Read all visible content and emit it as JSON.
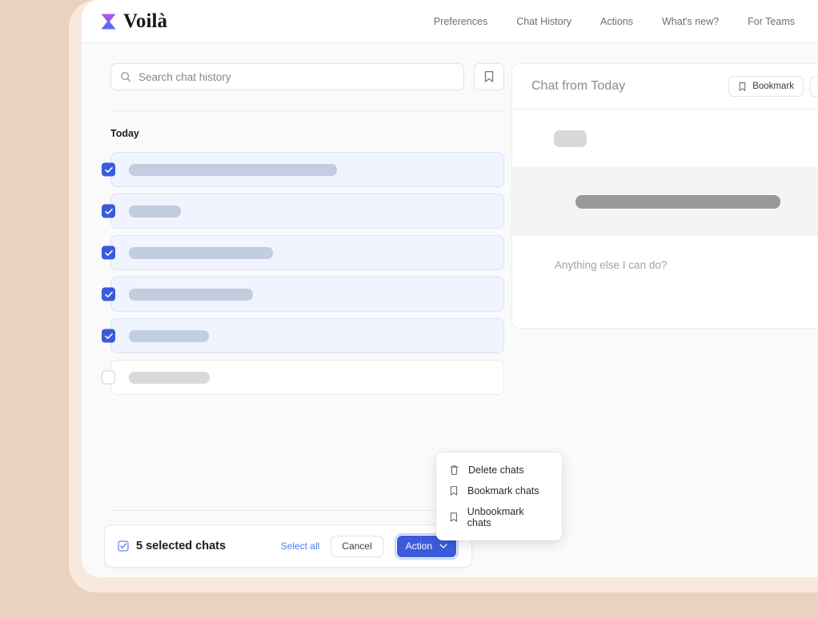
{
  "brand": {
    "name": "Voilà",
    "logo_icon": "hourglass-logo-icon",
    "gradient_from": "#c04ff0",
    "gradient_to": "#4f6ef7"
  },
  "nav": {
    "items": [
      {
        "label": "Preferences"
      },
      {
        "label": "Chat History"
      },
      {
        "label": "Actions"
      },
      {
        "label": "What's new?"
      },
      {
        "label": "For Teams"
      }
    ]
  },
  "search": {
    "placeholder": "Search chat history",
    "icon": "search-icon",
    "bookmark_filter_icon": "bookmark-icon"
  },
  "chat_list": {
    "section_label": "Today",
    "rows": [
      {
        "selected": true,
        "skeleton_width": 260
      },
      {
        "selected": true,
        "skeleton_width": 65
      },
      {
        "selected": true,
        "skeleton_width": 180
      },
      {
        "selected": true,
        "skeleton_width": 155
      },
      {
        "selected": true,
        "skeleton_width": 100
      },
      {
        "selected": false,
        "skeleton_width": 101
      }
    ]
  },
  "selection_bar": {
    "count_icon": "checkbox-checked-icon",
    "count_label": "5 selected chats",
    "select_all_label": "Select all",
    "cancel_label": "Cancel",
    "action_label": "Action",
    "action_chevron_icon": "chevron-down-icon",
    "accent_color": "#3b5bdb",
    "link_color": "#4d7cf3"
  },
  "dropdown": {
    "items": [
      {
        "label": "Delete chats",
        "icon": "trash-icon"
      },
      {
        "label": "Bookmark chats",
        "icon": "bookmark-icon"
      },
      {
        "label": "Unbookmark chats",
        "icon": "bookmark-icon"
      }
    ]
  },
  "chat_panel": {
    "title": "Chat from Today",
    "bookmark_label": "Bookmark",
    "bookmark_icon": "bookmark-icon",
    "followup_text": "Anything else I can do?"
  },
  "theme": {
    "page_background": "#e9d2c0",
    "frame_background": "#f8e9df",
    "app_background": "#fafafa"
  }
}
